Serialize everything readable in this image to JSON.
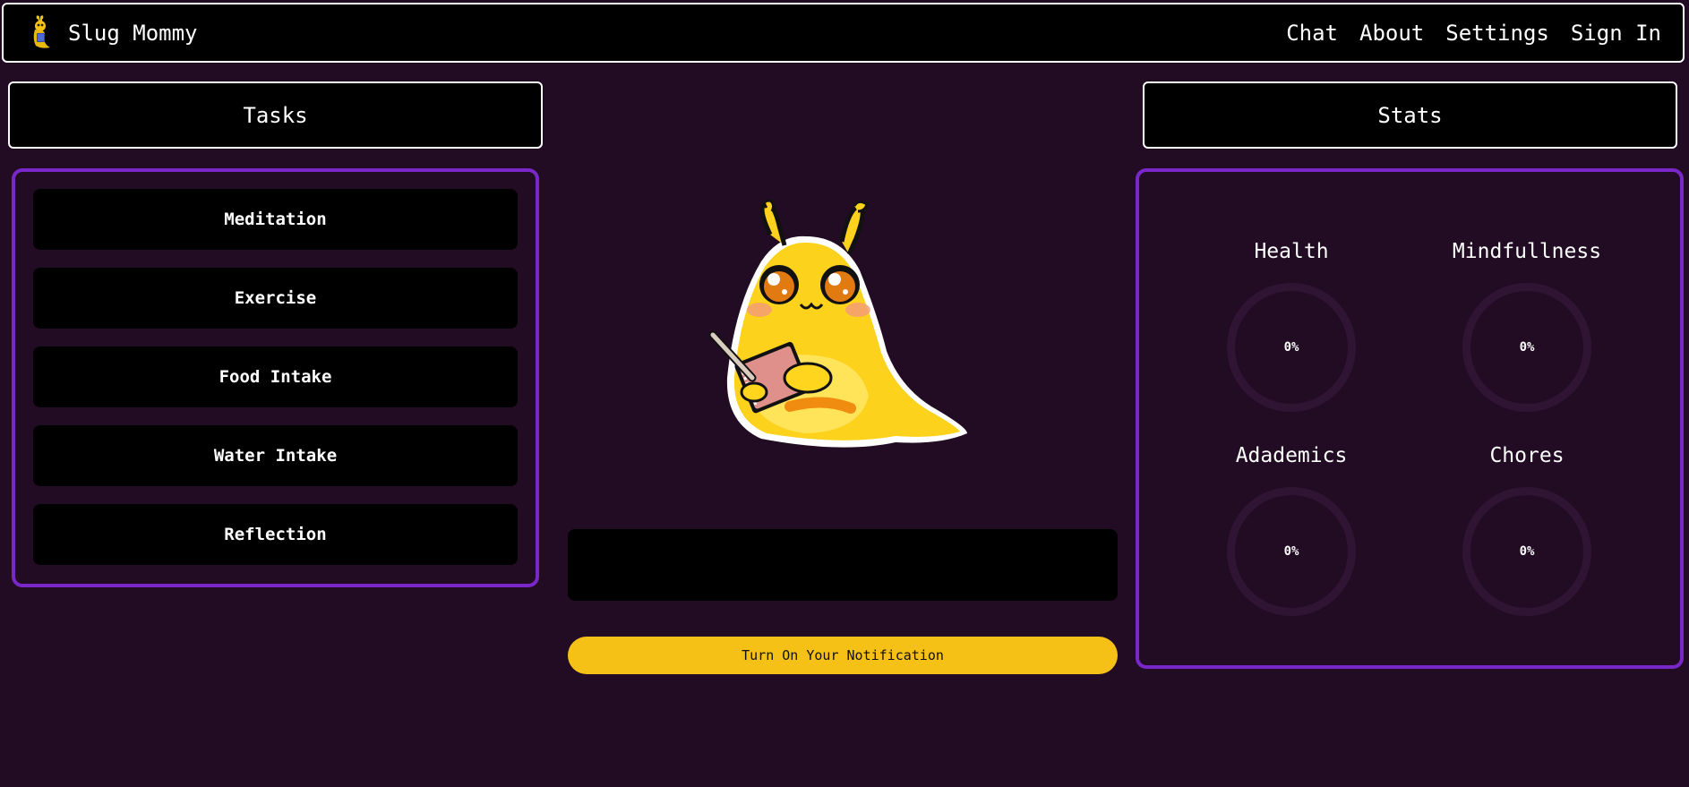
{
  "navbar": {
    "brand": "Slug Mommy",
    "links": [
      "Chat",
      "About",
      "Settings",
      "Sign In"
    ]
  },
  "tasks": {
    "title": "Tasks",
    "items": [
      "Meditation",
      "Exercise",
      "Food Intake",
      "Water Intake",
      "Reflection"
    ]
  },
  "main": {
    "message": "",
    "notify_label": "Turn On Your Notification"
  },
  "stats": {
    "title": "Stats",
    "items": [
      {
        "label": "Health",
        "value": "0%"
      },
      {
        "label": "Mindfullness",
        "value": "0%"
      },
      {
        "label": "Adademics",
        "value": "0%"
      },
      {
        "label": "Chores",
        "value": "0%"
      }
    ]
  },
  "colors": {
    "background": "#220c24",
    "panel_border": "#7a27c9",
    "accent": "#f5c117",
    "ring_track": "#2f1533"
  },
  "icons": {
    "brand": "slug-logo-icon",
    "mascot": "slug-mascot-writing-notebook"
  }
}
